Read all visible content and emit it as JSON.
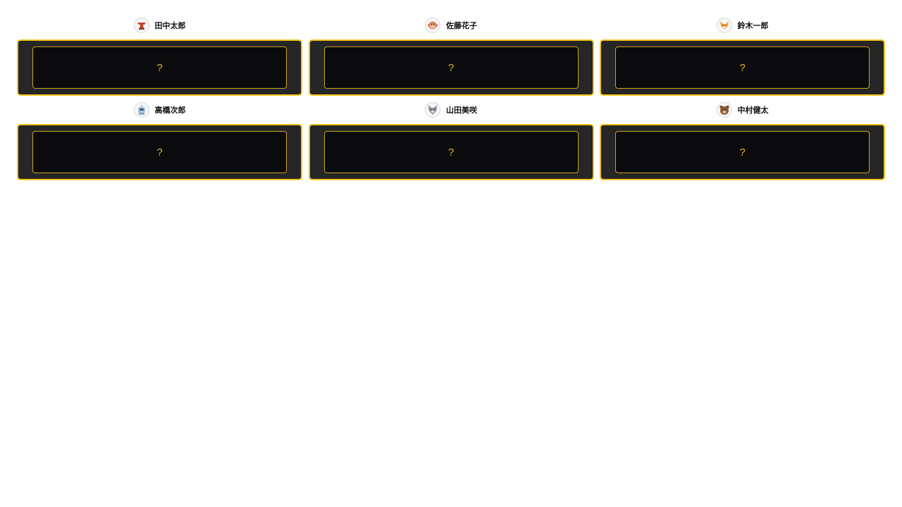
{
  "accent_color": "#f2c21b",
  "card_background": "#262626",
  "players": [
    {
      "name": "田中太郎",
      "avatar_icon": "anvil-icon",
      "card_value": "?"
    },
    {
      "name": "佐藤花子",
      "avatar_icon": "monkey-icon",
      "card_value": "?"
    },
    {
      "name": "鈴木一郎",
      "avatar_icon": "fox-icon",
      "card_value": "?"
    },
    {
      "name": "高橋次郎",
      "avatar_icon": "robot-icon",
      "card_value": "?"
    },
    {
      "name": "山田美咲",
      "avatar_icon": "wolf-icon",
      "card_value": "?"
    },
    {
      "name": "中村健太",
      "avatar_icon": "bear-icon",
      "card_value": "?"
    }
  ]
}
